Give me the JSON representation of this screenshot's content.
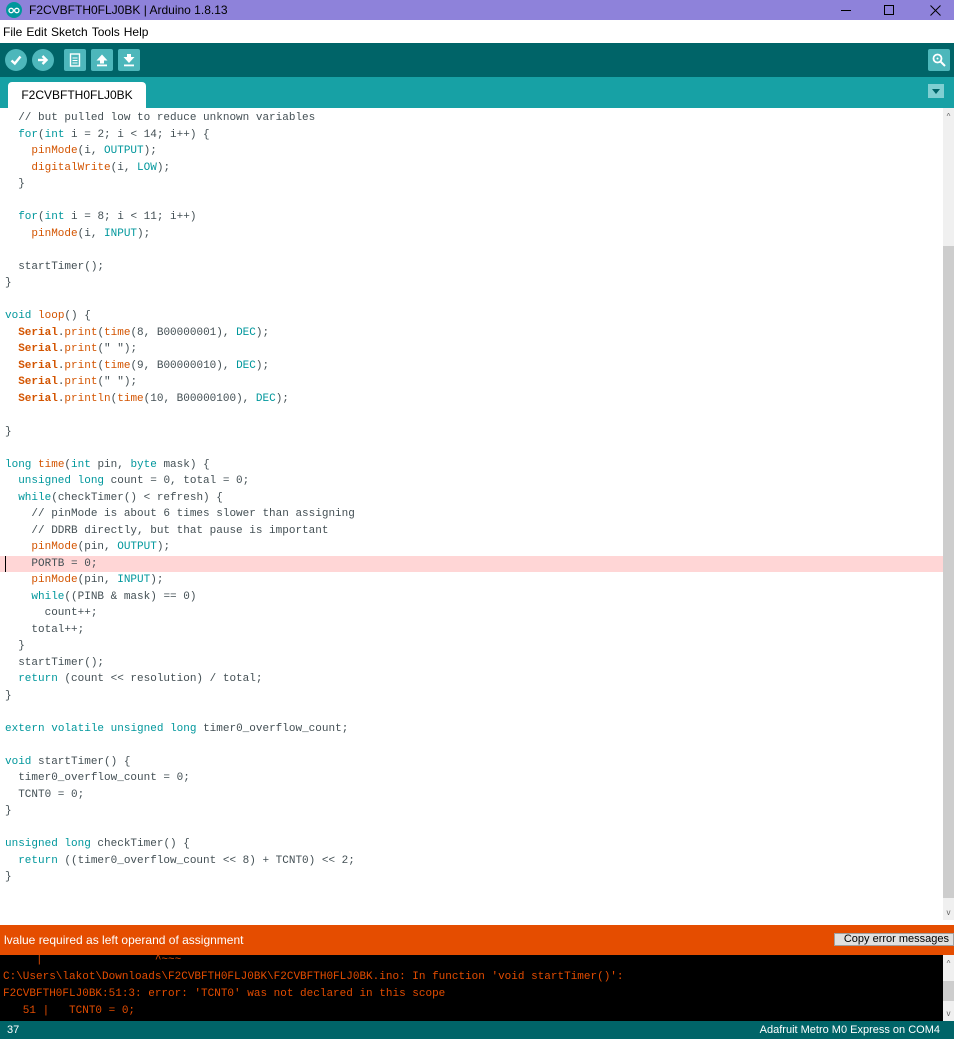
{
  "window": {
    "title": "F2CVBFTH0FLJ0BK | Arduino 1.8.13",
    "controls": [
      "minimize-icon",
      "maximize-icon",
      "close-icon"
    ]
  },
  "menu": {
    "items": [
      "File",
      "Edit",
      "Sketch",
      "Tools",
      "Help"
    ]
  },
  "toolbar": {
    "buttons": [
      "verify-icon",
      "upload-icon",
      "new-icon",
      "open-icon",
      "save-icon"
    ],
    "right": "serial-monitor-icon"
  },
  "tabs": {
    "active": "F2CVBFTH0FLJ0BK",
    "menu_icon": "chevron-down-icon"
  },
  "editor": {
    "highlighted_line": 27,
    "lines": [
      [
        [
          "  ",
          ""
        ],
        [
          "// but pulled low to reduce unknown variables",
          "com"
        ]
      ],
      [
        [
          "  ",
          ""
        ],
        [
          "for",
          "kw"
        ],
        [
          "(",
          ""
        ],
        [
          "int",
          "kw"
        ],
        [
          " i = 2; i < 14; i++) {",
          ""
        ]
      ],
      [
        [
          "    ",
          ""
        ],
        [
          "pinMode",
          "fn"
        ],
        [
          "(i, ",
          ""
        ],
        [
          "OUTPUT",
          "kw"
        ],
        [
          ");",
          ""
        ]
      ],
      [
        [
          "    ",
          ""
        ],
        [
          "digitalWrite",
          "fn"
        ],
        [
          "(i, ",
          ""
        ],
        [
          "LOW",
          "kw"
        ],
        [
          ");",
          ""
        ]
      ],
      [
        [
          "  }",
          ""
        ]
      ],
      [
        [
          "",
          ""
        ]
      ],
      [
        [
          "  ",
          ""
        ],
        [
          "for",
          "kw"
        ],
        [
          "(",
          ""
        ],
        [
          "int",
          "kw"
        ],
        [
          " i = 8; i < 11; i++)",
          ""
        ]
      ],
      [
        [
          "    ",
          ""
        ],
        [
          "pinMode",
          "fn"
        ],
        [
          "(i, ",
          ""
        ],
        [
          "INPUT",
          "kw"
        ],
        [
          ");",
          ""
        ]
      ],
      [
        [
          "",
          ""
        ]
      ],
      [
        [
          "  startTimer();",
          ""
        ]
      ],
      [
        [
          "}",
          ""
        ]
      ],
      [
        [
          "",
          ""
        ]
      ],
      [
        [
          "void",
          "kw"
        ],
        [
          " ",
          ""
        ],
        [
          "loop",
          "fn"
        ],
        [
          "() {",
          ""
        ]
      ],
      [
        [
          "  ",
          ""
        ],
        [
          "Serial",
          "obj"
        ],
        [
          ".",
          ""
        ],
        [
          "print",
          "fn"
        ],
        [
          "(",
          ""
        ],
        [
          "time",
          "fn"
        ],
        [
          "(8, B00000001), ",
          ""
        ],
        [
          "DEC",
          "kw"
        ],
        [
          ");",
          ""
        ]
      ],
      [
        [
          "  ",
          ""
        ],
        [
          "Serial",
          "obj"
        ],
        [
          ".",
          ""
        ],
        [
          "print",
          "fn"
        ],
        [
          "(\" \");",
          ""
        ]
      ],
      [
        [
          "  ",
          ""
        ],
        [
          "Serial",
          "obj"
        ],
        [
          ".",
          ""
        ],
        [
          "print",
          "fn"
        ],
        [
          "(",
          ""
        ],
        [
          "time",
          "fn"
        ],
        [
          "(9, B00000010), ",
          ""
        ],
        [
          "DEC",
          "kw"
        ],
        [
          ");",
          ""
        ]
      ],
      [
        [
          "  ",
          ""
        ],
        [
          "Serial",
          "obj"
        ],
        [
          ".",
          ""
        ],
        [
          "print",
          "fn"
        ],
        [
          "(\" \");",
          ""
        ]
      ],
      [
        [
          "  ",
          ""
        ],
        [
          "Serial",
          "obj"
        ],
        [
          ".",
          ""
        ],
        [
          "println",
          "fn"
        ],
        [
          "(",
          ""
        ],
        [
          "time",
          "fn"
        ],
        [
          "(10, B00000100), ",
          ""
        ],
        [
          "DEC",
          "kw"
        ],
        [
          ");",
          ""
        ]
      ],
      [
        [
          "",
          ""
        ]
      ],
      [
        [
          "}",
          ""
        ]
      ],
      [
        [
          "",
          ""
        ]
      ],
      [
        [
          "long",
          "kw"
        ],
        [
          " ",
          ""
        ],
        [
          "time",
          "fn"
        ],
        [
          "(",
          ""
        ],
        [
          "int",
          "kw"
        ],
        [
          " pin, ",
          ""
        ],
        [
          "byte",
          "kw"
        ],
        [
          " mask) {",
          ""
        ]
      ],
      [
        [
          "  ",
          ""
        ],
        [
          "unsigned",
          "kw"
        ],
        [
          " ",
          ""
        ],
        [
          "long",
          "kw"
        ],
        [
          " count = 0, total = 0;",
          ""
        ]
      ],
      [
        [
          "  ",
          ""
        ],
        [
          "while",
          "kw"
        ],
        [
          "(checkTimer() < refresh) {",
          ""
        ]
      ],
      [
        [
          "    ",
          ""
        ],
        [
          "// pinMode is about 6 times slower than assigning",
          "com"
        ]
      ],
      [
        [
          "    ",
          ""
        ],
        [
          "// DDRB directly, but that pause is important",
          "com"
        ]
      ],
      [
        [
          "    ",
          ""
        ],
        [
          "pinMode",
          "fn"
        ],
        [
          "(pin, ",
          ""
        ],
        [
          "OUTPUT",
          "kw"
        ],
        [
          ");",
          ""
        ]
      ],
      [
        [
          "    PORTB = 0;",
          ""
        ]
      ],
      [
        [
          "    ",
          ""
        ],
        [
          "pinMode",
          "fn"
        ],
        [
          "(pin, ",
          ""
        ],
        [
          "INPUT",
          "kw"
        ],
        [
          ");",
          ""
        ]
      ],
      [
        [
          "    ",
          ""
        ],
        [
          "while",
          "kw"
        ],
        [
          "((PINB & mask) == 0)",
          ""
        ]
      ],
      [
        [
          "      count++;",
          ""
        ]
      ],
      [
        [
          "    total++;",
          ""
        ]
      ],
      [
        [
          "  }",
          ""
        ]
      ],
      [
        [
          "  startTimer();",
          ""
        ]
      ],
      [
        [
          "  ",
          ""
        ],
        [
          "return",
          "kw"
        ],
        [
          " (count << resolution) / total;",
          ""
        ]
      ],
      [
        [
          "}",
          ""
        ]
      ],
      [
        [
          "",
          ""
        ]
      ],
      [
        [
          "extern",
          "kw"
        ],
        [
          " ",
          ""
        ],
        [
          "volatile",
          "kw"
        ],
        [
          " ",
          ""
        ],
        [
          "unsigned",
          "kw"
        ],
        [
          " ",
          ""
        ],
        [
          "long",
          "kw"
        ],
        [
          " timer0_overflow_count;",
          ""
        ]
      ],
      [
        [
          "",
          ""
        ]
      ],
      [
        [
          "void",
          "kw"
        ],
        [
          " startTimer() {",
          ""
        ]
      ],
      [
        [
          "  timer0_overflow_count = 0;",
          ""
        ]
      ],
      [
        [
          "  TCNT0 = 0;",
          ""
        ]
      ],
      [
        [
          "}",
          ""
        ]
      ],
      [
        [
          "",
          ""
        ]
      ],
      [
        [
          "unsigned",
          "kw"
        ],
        [
          " ",
          ""
        ],
        [
          "long",
          "kw"
        ],
        [
          " checkTimer() {",
          ""
        ]
      ],
      [
        [
          "  ",
          ""
        ],
        [
          "return",
          "kw"
        ],
        [
          " ((timer0_overflow_count << 8) + TCNT0) << 2;",
          ""
        ]
      ],
      [
        [
          "}",
          ""
        ]
      ]
    ]
  },
  "status": {
    "message": "lvalue required as left operand of assignment",
    "copy_button": "Copy error messages"
  },
  "console": {
    "lines": [
      "     |                 ^~~~",
      "C:\\Users\\lakot\\Downloads\\F2CVBFTH0FLJ0BK\\F2CVBFTH0FLJ0BK.ino: In function 'void startTimer()':",
      "F2CVBFTH0FLJ0BK:51:3: error: 'TCNT0' was not declared in this scope",
      "   51 |   TCNT0 = 0;",
      "      |   ^~~~~"
    ]
  },
  "footer": {
    "line_number": "37",
    "board": "Adafruit Metro M0 Express on COM4"
  },
  "colors": {
    "titlebar": "#8e82da",
    "toolbar": "#006468",
    "tabbar": "#17a1a5",
    "error_bar": "#e54d00",
    "console_text": "#e34c00",
    "highlight_line": "#ffd6d6",
    "keyword": "#00979c",
    "function": "#d35400"
  }
}
